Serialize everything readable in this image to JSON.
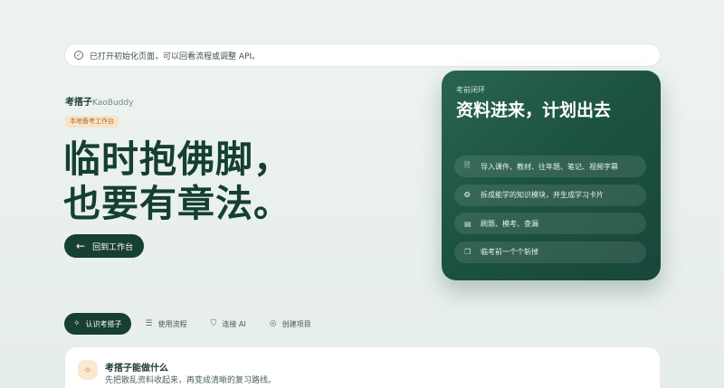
{
  "notice": {
    "icon": "check-circle-icon",
    "text": "已打开初始化页面，可以回看流程或调整 API。"
  },
  "brand": {
    "name": "考搭子",
    "name_en": "KaoBuddy"
  },
  "tag": "本地备考工作台",
  "hero": {
    "line1": "临时抱佛脚，",
    "line2": "也要有章法。"
  },
  "back_button": {
    "icon": "arrow-left-icon",
    "label": "回到工作台"
  },
  "card": {
    "kicker": "考前闭环",
    "title": "资料进来，计划出去",
    "items": [
      {
        "icon": "file-icon",
        "label": "导入课件、教材、往年题、笔记、视频字幕"
      },
      {
        "icon": "brain-icon",
        "label": "拆成能学的知识模块，并生成学习卡片"
      },
      {
        "icon": "clipboard-icon",
        "label": "刷题、模考、查漏"
      },
      {
        "icon": "cards-icon",
        "label": "临考前一个个斩掉"
      }
    ]
  },
  "tabs": [
    {
      "icon": "sparkle-icon",
      "label": "认识考搭子",
      "active": true
    },
    {
      "icon": "list-icon",
      "label": "使用流程",
      "active": false
    },
    {
      "icon": "shield-icon",
      "label": "连接 AI",
      "active": false
    },
    {
      "icon": "target-icon",
      "label": "创建项目",
      "active": false
    }
  ],
  "feature": {
    "icon": "sparkle-icon",
    "title": "考搭子能做什么",
    "desc": "先把散乱资料收起来，再变成清晰的复习路线。"
  },
  "colors": {
    "accent": "#173f33",
    "tag_bg": "#f7e3c8",
    "tag_text": "#b26b2a"
  }
}
